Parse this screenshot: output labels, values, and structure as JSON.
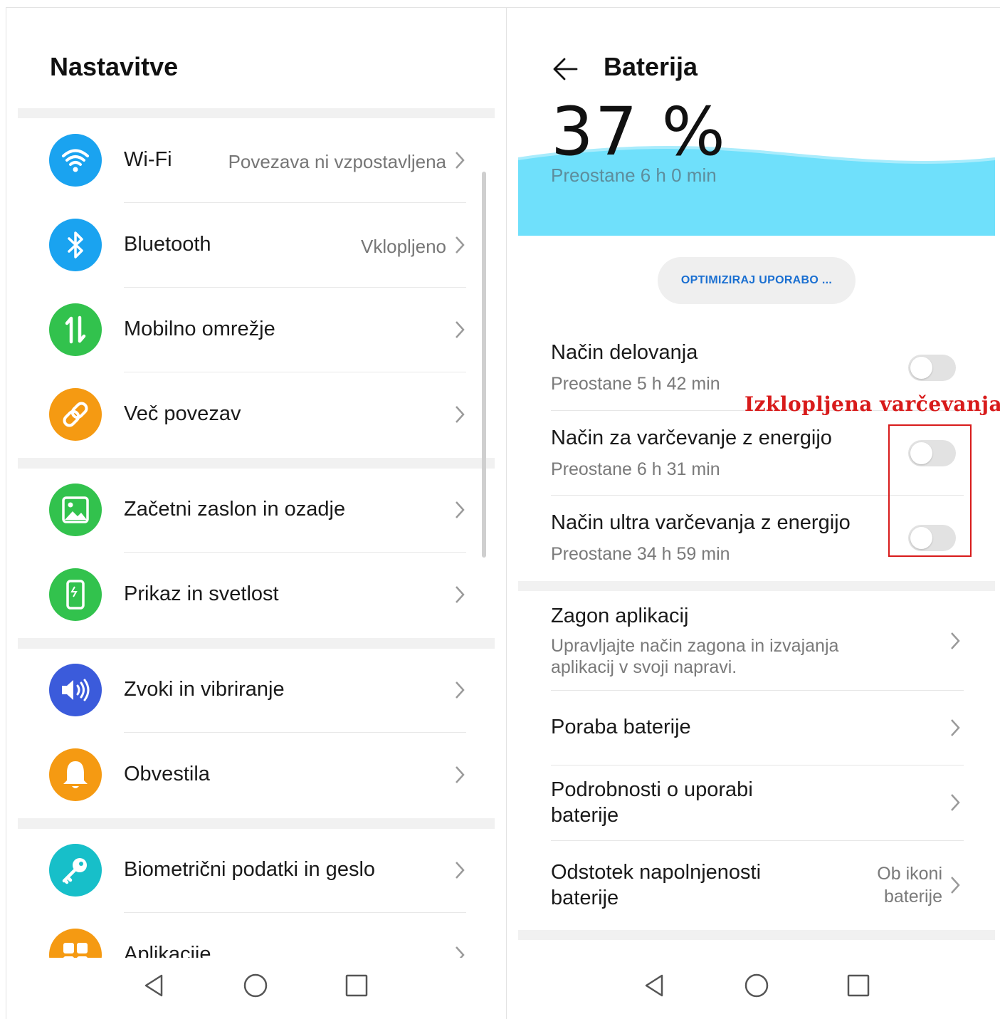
{
  "left": {
    "title": "Nastavitve",
    "items": [
      {
        "label": "Wi-Fi",
        "value": "Povezava ni vzpostavljena",
        "icon": "wifi-icon",
        "color": "#1aa3f0"
      },
      {
        "label": "Bluetooth",
        "value": "Vklopljeno",
        "icon": "bluetooth-icon",
        "color": "#1aa3f0"
      },
      {
        "label": "Mobilno omrežje",
        "value": "",
        "icon": "mobile-data-icon",
        "color": "#32c24d"
      },
      {
        "label": "Več povezav",
        "value": "",
        "icon": "link-icon",
        "color": "#f59a12"
      },
      {
        "label": "Začetni zaslon in ozadje",
        "value": "",
        "icon": "image-icon",
        "color": "#32c24d"
      },
      {
        "label": "Prikaz in svetlost",
        "value": "",
        "icon": "display-icon",
        "color": "#32c24d"
      },
      {
        "label": "Zvoki in vibriranje",
        "value": "",
        "icon": "sound-icon",
        "color": "#3b5bdb"
      },
      {
        "label": "Obvestila",
        "value": "",
        "icon": "bell-icon",
        "color": "#f59a12"
      },
      {
        "label": "Biometrični podatki in geslo",
        "value": "",
        "icon": "key-icon",
        "color": "#17bfc9"
      },
      {
        "label": "Aplikacije",
        "value": "",
        "icon": "apps-icon",
        "color": "#f59a12"
      }
    ]
  },
  "right": {
    "title": "Baterija",
    "percent": "37 %",
    "remaining": "Preostane 6 h 0 min",
    "optimize_button": "OPTIMIZIRAJ UPORABO ...",
    "modes": [
      {
        "title": "Način delovanja",
        "sub": "Preostane 5 h 42 min",
        "on": false
      },
      {
        "title": "Način za varčevanje z energijo",
        "sub": "Preostane 6 h 31 min",
        "on": false
      },
      {
        "title": "Način ultra varčevanja z energijo",
        "sub": "Preostane 34 h 59 min",
        "on": false
      }
    ],
    "annotation": "Izklopljena varčevanja !",
    "links": [
      {
        "title": "Zagon aplikacij",
        "sub_line1": "Upravljajte način zagona in izvajanja",
        "sub_line2": "aplikacij v svoji napravi."
      },
      {
        "title": "Poraba baterije"
      },
      {
        "title_line1": "Podrobnosti o uporabi",
        "title_line2": "baterije"
      },
      {
        "title_line1": "Odstotek napolnjenosti",
        "title_line2": "baterije",
        "value_line1": "Ob ikoni",
        "value_line2": "baterije"
      }
    ],
    "wave_color": "#6fe0fb",
    "accent_color": "#1a6fd1",
    "annotation_color": "#d81b1b"
  },
  "navbar": {
    "back": "back-icon",
    "home": "home-icon",
    "recents": "recents-icon"
  }
}
